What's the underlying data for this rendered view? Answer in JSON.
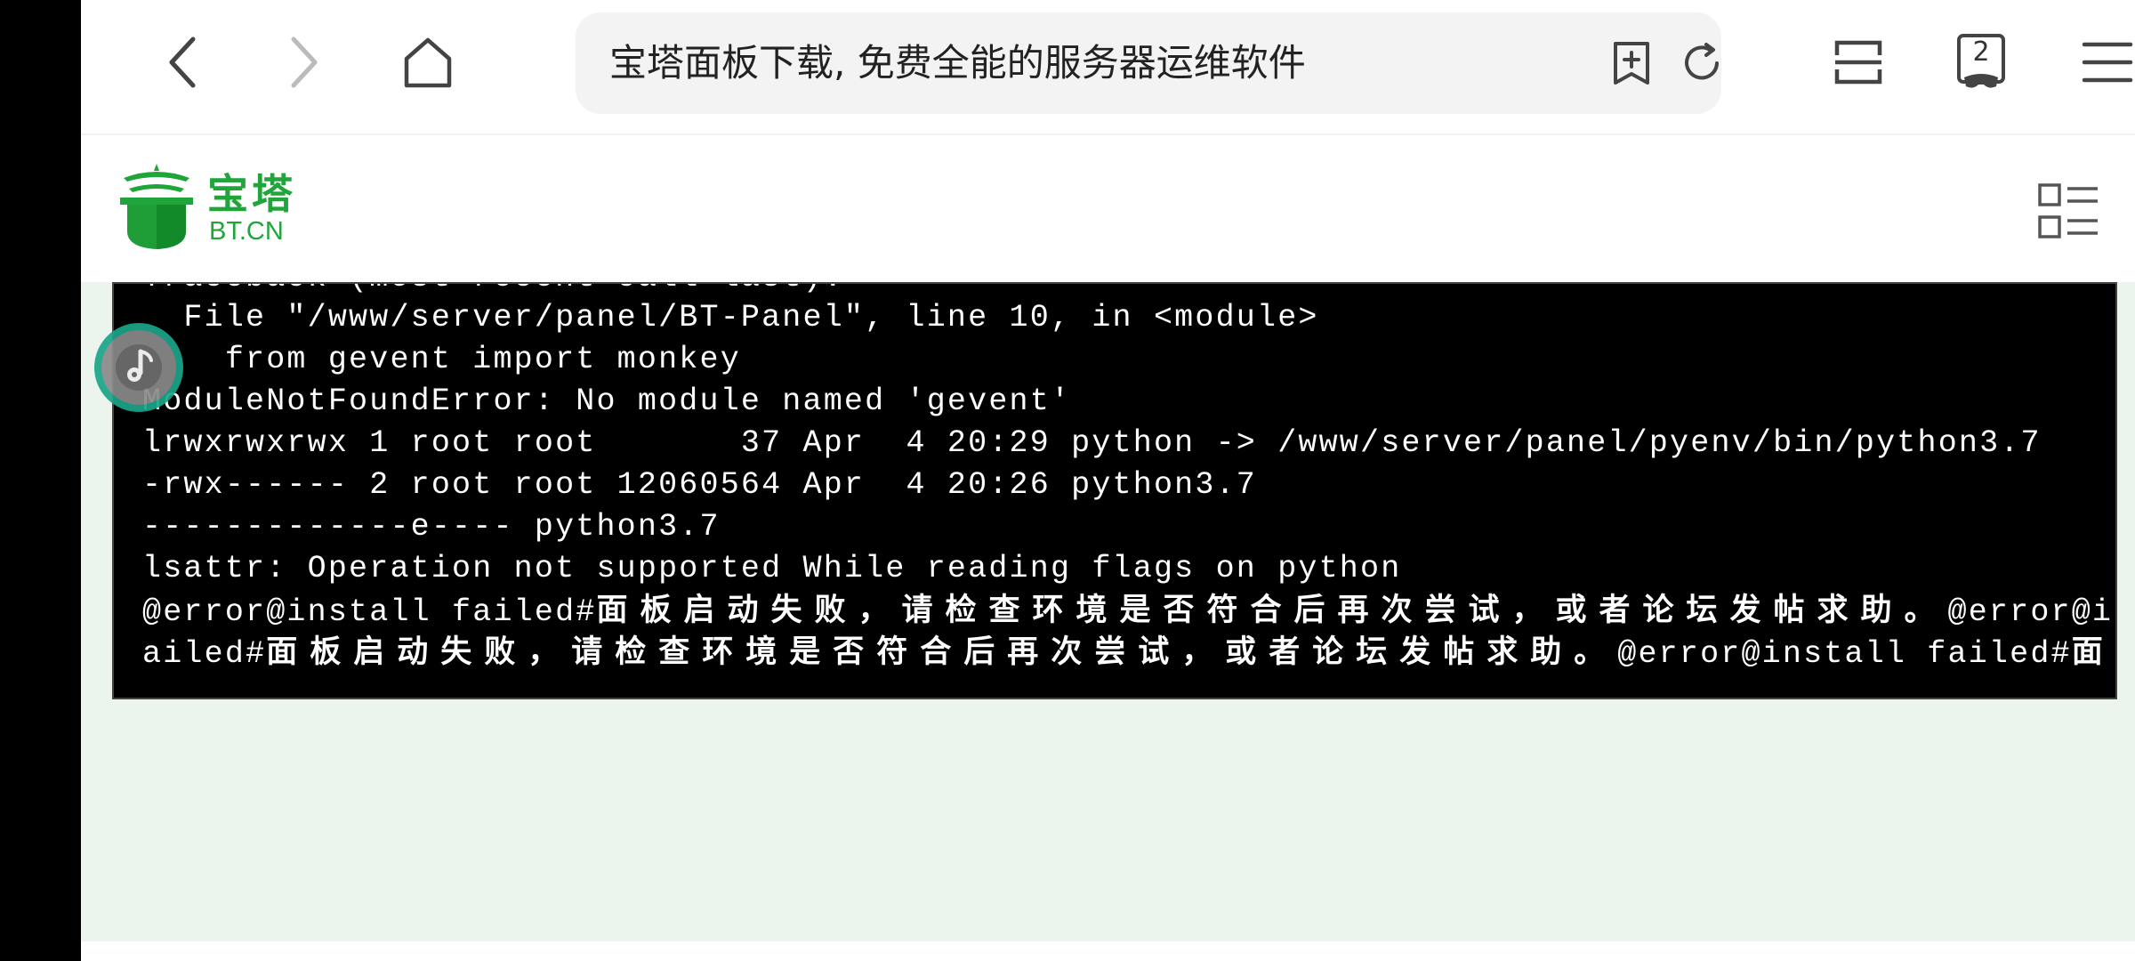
{
  "browser": {
    "page_title": "宝塔面板下载, 免费全能的服务器运维软件",
    "tab_count": "2",
    "icons": {
      "back": "back-arrow-icon",
      "forward": "forward-arrow-icon",
      "home": "home-icon",
      "shield": "security-shield-icon",
      "add_bookmark": "add-bookmark-icon",
      "reload": "reload-icon",
      "reader": "reader-mode-icon",
      "tabs": "incognito-tabs-icon",
      "menu": "hamburger-menu-icon"
    },
    "shield_color": "#35c0b0"
  },
  "site": {
    "logo_cn": "宝塔",
    "logo_en": "BT.CN",
    "brand_color": "#20a53a",
    "menu_icon": "list-menu-icon"
  },
  "terminal": {
    "lines": [
      "Traceback (most recent call last):",
      "  File \"/www/server/panel/BT-Panel\", line 10, in <module>",
      "    from gevent import monkey",
      "ModuleNotFoundError: No module named 'gevent'",
      "lrwxrwxrwx 1 root root       37 Apr  4 20:29 python -> /www/server/panel/pyenv/bin/python3.7",
      "-rwx------ 2 root root 12060564 Apr  4 20:26 python3.7",
      "-------------e---- python3.7",
      "lsattr: Operation not supported While reading flags on python"
    ],
    "error_line_1": {
      "prefix": "@error@install failed#",
      "message": "面板启动失败，请检查环境是否符合后再次尝试，或者论坛发帖求助。",
      "suffix": "@error@ins"
    },
    "error_line_2": {
      "prefix": "ailed#",
      "message": "面板启动失败，请检查环境是否符合后再次尝试，或者论坛发帖求助。",
      "suffix": "@error@install failed#",
      "tail": "面板"
    }
  },
  "floating_button": {
    "icon": "music-note-icon"
  }
}
